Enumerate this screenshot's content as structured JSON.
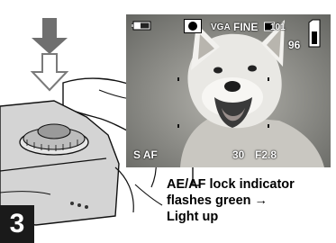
{
  "step": {
    "number": "3"
  },
  "lcd": {
    "image_size": "VGA",
    "quality": "FINE",
    "folder": "101",
    "remaining": "96",
    "focus_mode": "S AF",
    "shutter": "30",
    "aperture": "F2.8"
  },
  "caption": {
    "line1": "AE/AF lock indicator",
    "line2": "flashes green →",
    "line3": "Light up"
  },
  "colors": {
    "step_bg": "#1a1a1a",
    "text": "#000000",
    "osd": "#ffffff"
  },
  "icons": [
    "down-arrow-icon",
    "outline-arrow-icon",
    "battery-icon",
    "ae-af-lock-indicator-icon",
    "memory-card-icon",
    "folder-icon"
  ]
}
